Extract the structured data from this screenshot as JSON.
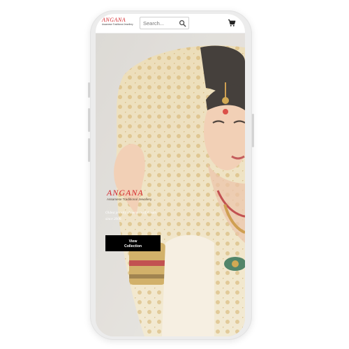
{
  "header": {
    "logo": {
      "name": "ANGANA",
      "subtitle": "Assamese Traditional Jewellery"
    },
    "search": {
      "placeholder": "Search...",
      "icon": "search-icon"
    },
    "cart": {
      "icon": "cart-icon"
    }
  },
  "hero": {
    "image": "assamese-bride-portrait",
    "logo": {
      "name": "ANGANA",
      "subtitle": "Assamese Traditional Jewellery"
    },
    "tagline": "Oldest jewelry showroom of Assam since 2000.",
    "cta_label": "View Collection"
  },
  "colors": {
    "brand_red": "#d3262b",
    "cta_background": "#000000",
    "cta_text": "#ffffff",
    "device_frame": "#ececec"
  }
}
